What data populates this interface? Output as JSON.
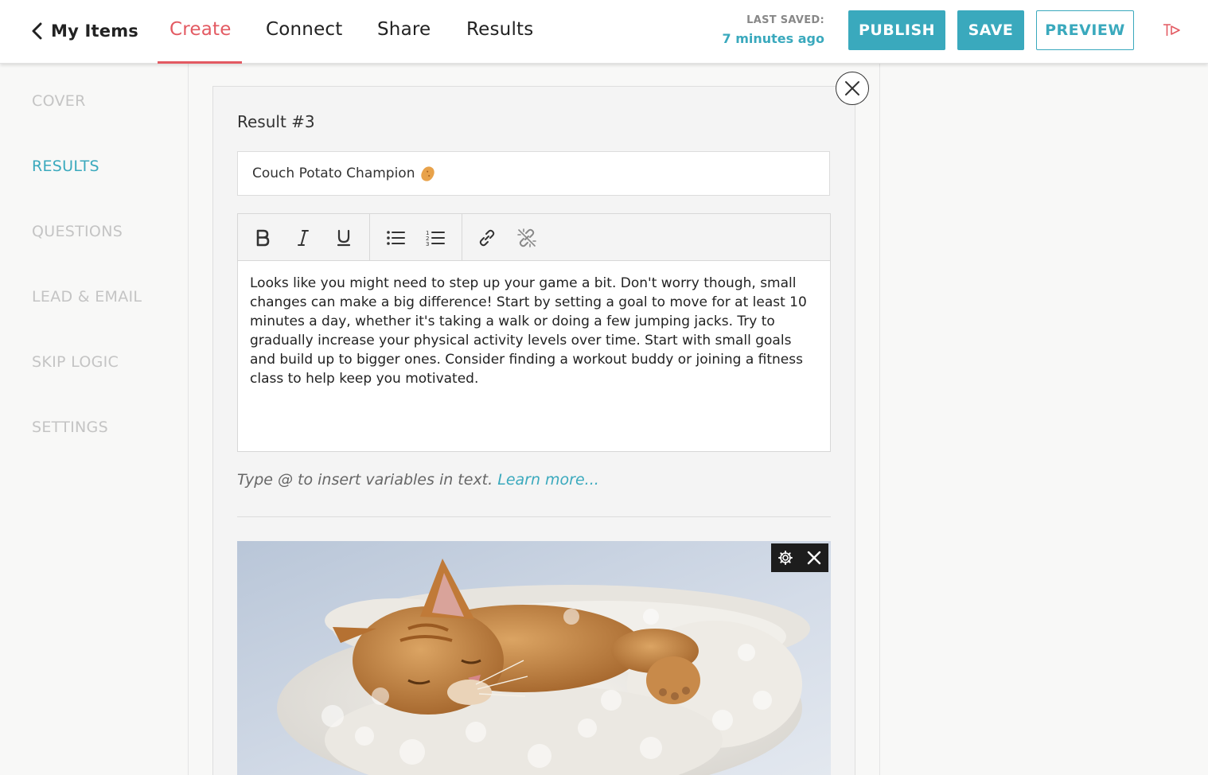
{
  "header": {
    "back_label": "My Items",
    "tabs": [
      {
        "label": "Create",
        "active": true
      },
      {
        "label": "Connect",
        "active": false
      },
      {
        "label": "Share",
        "active": false
      },
      {
        "label": "Results",
        "active": false
      }
    ],
    "last_saved_label": "LAST SAVED:",
    "last_saved_time": "7 minutes ago",
    "publish_label": "PUBLISH",
    "save_label": "SAVE",
    "preview_label": "PREVIEW",
    "accent_color": "#3aa9bd",
    "active_tab_color": "#e35a62"
  },
  "sidebar": {
    "items": [
      {
        "label": "COVER",
        "active": false
      },
      {
        "label": "RESULTS",
        "active": true
      },
      {
        "label": "QUESTIONS",
        "active": false
      },
      {
        "label": "LEAD & EMAIL",
        "active": false
      },
      {
        "label": "SKIP LOGIC",
        "active": false
      },
      {
        "label": "SETTINGS",
        "active": false
      }
    ]
  },
  "result": {
    "heading": "Result #3",
    "title_value": "Couch Potato Champion",
    "title_emoji": "potato-icon",
    "toolbar": [
      "bold-icon",
      "italic-icon",
      "underline-icon",
      "bullet-list-icon",
      "numbered-list-icon",
      "link-icon",
      "unlink-icon"
    ],
    "description": "Looks like you might need to step up your game a bit. Don't worry though, small changes can make a big difference! Start by setting a goal to move for at least 10 minutes a day, whether it's taking a walk or doing a few jumping jacks. Try to gradually increase your physical activity levels over time. Start with small goals and build up to bigger ones. Consider finding a workout buddy or joining a fitness class to help keep you motivated.",
    "hint_text": "Type @ to insert variables in text.",
    "hint_link": "Learn more...",
    "image_tools": [
      "gear-icon",
      "close-icon"
    ]
  }
}
